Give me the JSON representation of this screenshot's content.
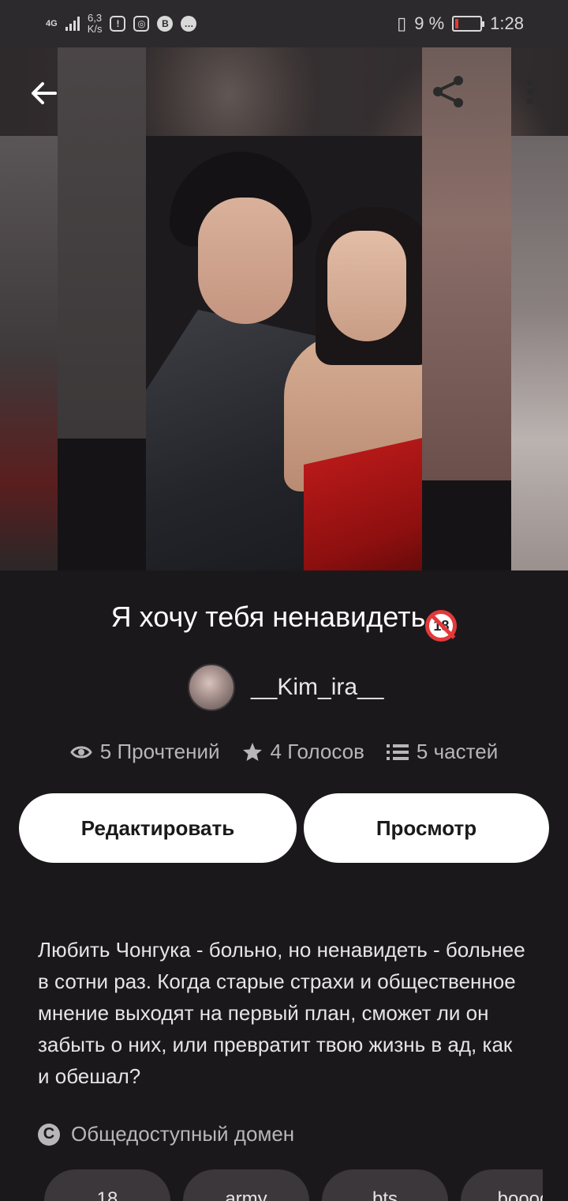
{
  "status_bar": {
    "network_type": "4G",
    "speed_value": "6,3",
    "speed_unit": "K/s",
    "battery_percent": "9 %",
    "time": "1:28",
    "icons": [
      "signal-icon",
      "alert-icon",
      "instagram-icon",
      "vk-icon",
      "message-icon",
      "vibrate-icon",
      "battery-icon"
    ]
  },
  "toolbar": {
    "back_icon": "arrow-left-icon",
    "share_icon": "share-icon",
    "more_icon": "more-vertical-icon"
  },
  "story": {
    "title": "Я хочу тебя ненавидеть",
    "badge": "18",
    "author": "__Kim_ira__",
    "stats": {
      "reads": "5 Прочтений",
      "votes": "4 Голосов",
      "parts": "5 частей"
    },
    "description": "Любить Чонгука - больно, но ненавидеть - больнее в сотни раз. Когда старые страхи и общественное мнение выходят на первый план, сможет ли он забыть о них, или превратит твою жизнь в ад, как и обешал?",
    "license": "Общедоступный домен"
  },
  "buttons": {
    "edit_label": "Редактировать",
    "view_label": "Просмотр"
  },
  "tags": [
    "18",
    "army",
    "bts",
    "boooo"
  ],
  "colors": {
    "background": "#1b181b",
    "button_bg": "#ffffff",
    "badge_red": "#e23a3a",
    "muted_text": "#b9b5b9"
  }
}
